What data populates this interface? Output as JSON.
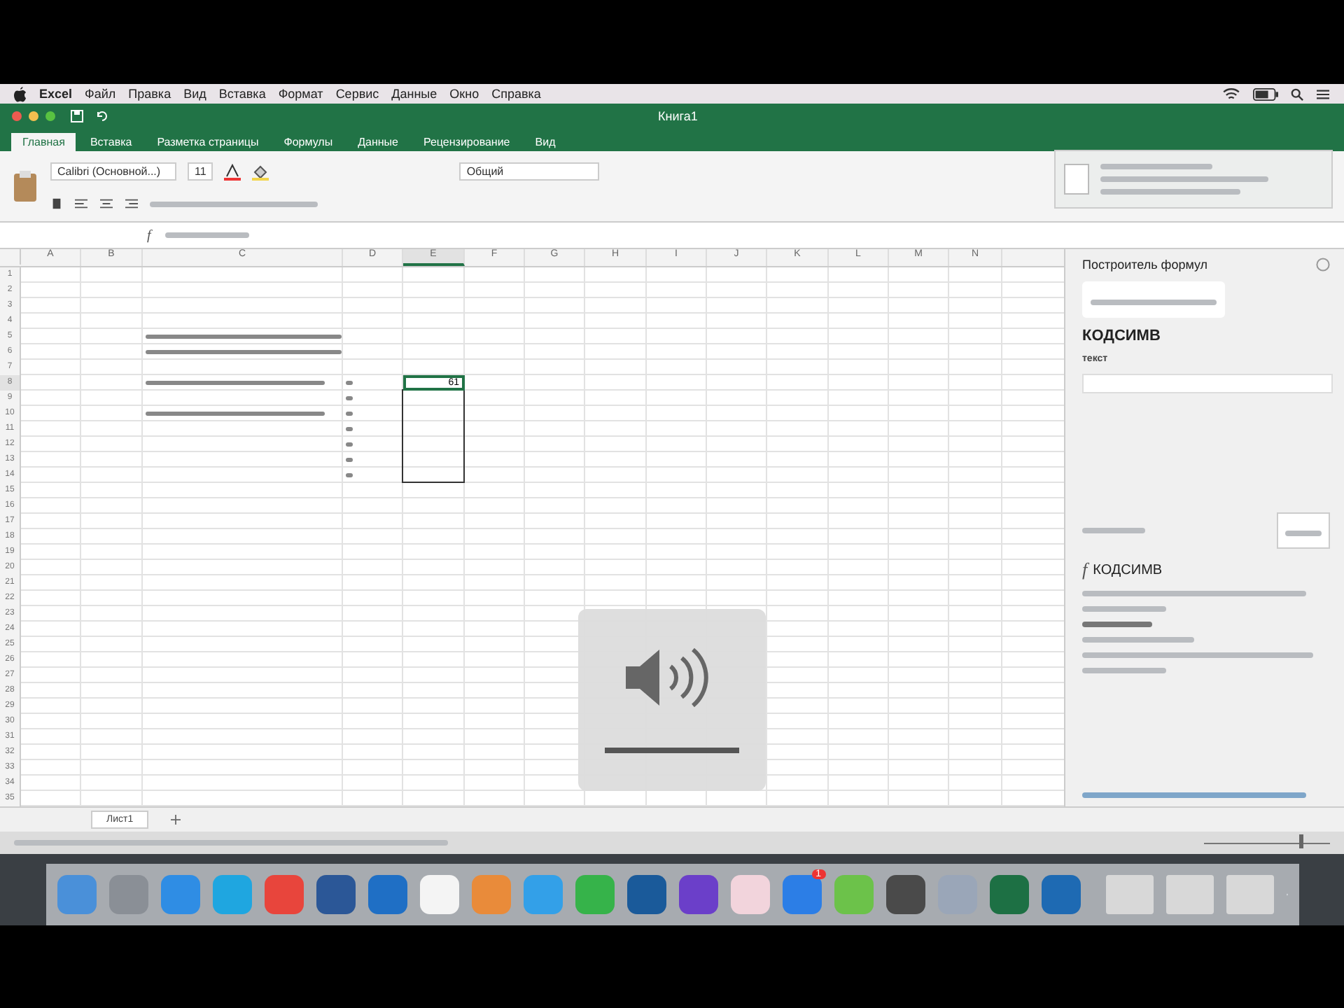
{
  "menu_bar": {
    "items": [
      "Excel",
      "Файл",
      "Правка",
      "Вид",
      "Вставка",
      "Формат",
      "Сервис",
      "Данные",
      "Окно",
      "Справка"
    ]
  },
  "window": {
    "title": "Книга1"
  },
  "ribbon": {
    "tabs": [
      {
        "label": "Главная",
        "selected": true
      },
      {
        "label": "Вставка",
        "selected": false
      },
      {
        "label": "Разметка страницы",
        "selected": false
      },
      {
        "label": "Формулы",
        "selected": false
      },
      {
        "label": "Данные",
        "selected": false
      },
      {
        "label": "Рецензирование",
        "selected": false
      },
      {
        "label": "Вид",
        "selected": false
      }
    ],
    "font_name": "Calibri (Основной...)",
    "font_size": "11",
    "number_format": "Общий"
  },
  "sheet": {
    "columns": [
      "A",
      "B",
      "C",
      "D",
      "E",
      "F",
      "G",
      "H",
      "I",
      "J",
      "K",
      "L",
      "M",
      "N"
    ],
    "rows": [
      "1",
      "2",
      "3",
      "4",
      "5",
      "6",
      "7",
      "8",
      "9",
      "10",
      "11",
      "12",
      "13",
      "14",
      "15",
      "16",
      "17",
      "18",
      "19",
      "20",
      "21",
      "22",
      "23",
      "24",
      "25",
      "26",
      "27",
      "28",
      "29",
      "30",
      "31",
      "32",
      "33",
      "34",
      "35"
    ],
    "active_cell_value": "61"
  },
  "formula_builder": {
    "title": "Построитель формул",
    "function_name": "КОДСИМВ",
    "argument_label": "текст",
    "help_function_name": "КОДСИМВ"
  },
  "sheet_tabs": [
    {
      "label": "Лист1",
      "selected": true
    }
  ],
  "volume": {
    "level": 1
  },
  "formula_bar": {
    "function_symbol": "f"
  },
  "help_symbol": "f",
  "zoom_slider": {
    "level": 0.75
  },
  "dock": [
    {
      "color": "#4a90d9"
    },
    {
      "color": "#8a8f96"
    },
    {
      "color": "#2f8de4"
    },
    {
      "color": "#1fa6e0"
    },
    {
      "color": "#e8453c"
    },
    {
      "color": "#2b5797"
    },
    {
      "color": "#1f6fc5"
    },
    {
      "color": "#f4f4f4"
    },
    {
      "color": "#e98b3a"
    },
    {
      "color": "#33a0e8"
    },
    {
      "color": "#36b34a"
    },
    {
      "color": "#1a5a9a"
    },
    {
      "color": "#6b3fc9"
    },
    {
      "color": "#f2d4dc"
    },
    {
      "color": "#2c7ee6"
    },
    {
      "color": "#6cc24a"
    },
    {
      "color": "#4a4a4a"
    },
    {
      "color": "#9aa6b8"
    },
    {
      "color": "#1d7044"
    },
    {
      "color": "#1e6ab3"
    }
  ],
  "dock_badge": "1"
}
